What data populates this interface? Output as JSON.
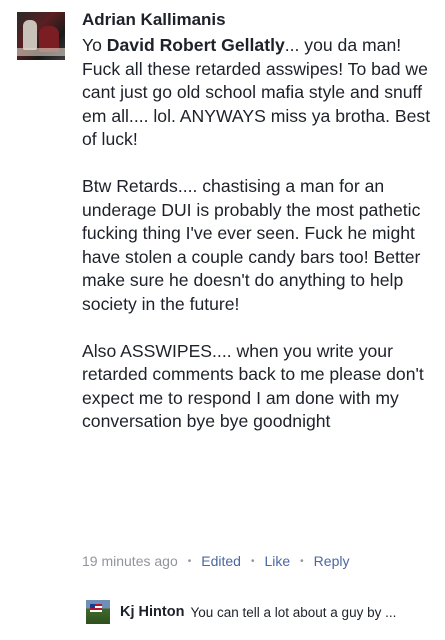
{
  "comment": {
    "author": "Adrian Kallimanis",
    "paragraphs": [
      {
        "before": "Yo ",
        "mention": "David Robert Gellatly",
        "after": "... you da man!  Fuck all these retarded asswipes! To bad we cant just go old school mafia style and snuff em all.... lol.   ANYWAYS miss ya brotha.  Best of luck!"
      },
      {
        "text": "Btw Retards.... chastising a man for an underage DUI is probably the most pathetic fucking thing I've ever seen. Fuck he might have stolen a couple candy bars too! Better make sure he doesn't do anything to help society in the future!"
      },
      {
        "text": "Also ASSWIPES.... when you write your retarded comments back to me please don't expect me to respond I am done with my conversation bye bye goodnight"
      }
    ],
    "meta": {
      "time": "19 minutes ago",
      "edited": "Edited",
      "like": "Like",
      "reply": "Reply",
      "separator": "•"
    }
  },
  "reply_preview": {
    "author": "Kj Hinton",
    "text": "You can tell a lot about a guy by ..."
  }
}
